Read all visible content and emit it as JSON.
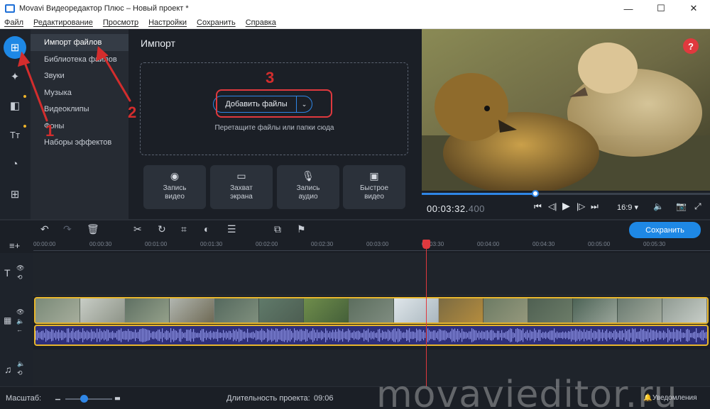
{
  "window": {
    "title": "Movavi Видеоредактор Плюс – Новый проект *",
    "minimize_glyph": "—",
    "maximize_glyph": "☐",
    "close_glyph": "✕"
  },
  "menu": [
    "Файл",
    "Редактирование",
    "Просмотр",
    "Настройки",
    "Сохранить",
    "Справка"
  ],
  "rail": [
    {
      "icon": "import-icon",
      "glyph": "⊞",
      "active": true
    },
    {
      "icon": "filters-magic-icon",
      "glyph": "✦",
      "active": false
    },
    {
      "icon": "transitions-icon",
      "glyph": "◧",
      "active": false
    },
    {
      "icon": "titles-icon",
      "glyph": "Tт",
      "active": false
    },
    {
      "icon": "stickers-icon",
      "glyph": "◔",
      "active": false
    },
    {
      "icon": "more-tools-icon",
      "glyph": "⊞",
      "active": false
    }
  ],
  "categories": [
    "Импорт файлов",
    "Библиотека файлов",
    "Звуки",
    "Музыка",
    "Видеоклипы",
    "Фоны",
    "Наборы эффектов"
  ],
  "import": {
    "title": "Импорт",
    "add_files_label": "Добавить файлы",
    "drop_hint": "Перетащите файлы или папки сюда",
    "tiles": [
      {
        "label_line1": "Запись",
        "label_line2": "видео",
        "icon": "webcam-icon",
        "glyph": "◉"
      },
      {
        "label_line1": "Захват",
        "label_line2": "экрана",
        "icon": "screen-capture-icon",
        "glyph": "▭"
      },
      {
        "label_line1": "Запись",
        "label_line2": "аудио",
        "icon": "microphone-icon",
        "glyph": "🎙"
      },
      {
        "label_line1": "Быстрое",
        "label_line2": "видео",
        "icon": "quick-video-icon",
        "glyph": "▣"
      }
    ]
  },
  "annotations": {
    "one": "1",
    "two": "2",
    "three": "3"
  },
  "preview": {
    "help_label": "?",
    "timecode_main": "00:03:32.",
    "timecode_ms": "400",
    "aspect_ratio": "16:9 ▾",
    "playback_progress_percent": 39.5
  },
  "timeline": {
    "save_label": "Сохранить",
    "ruler_ticks": [
      "00:00:00",
      "00:00:30",
      "00:01:00",
      "00:01:30",
      "00:02:00",
      "00:02:30",
      "00:03:00",
      "00:03:30",
      "00:04:00",
      "00:04:30",
      "00:05:00",
      "00:05:30"
    ]
  },
  "status": {
    "scale_label": "Масштаб:",
    "duration_label": "Длительность проекта:",
    "duration_value": "09:06",
    "notifications_label": "Уведомления",
    "zoom_level_percent": 40
  },
  "watermark": "movavieditor.ru",
  "colors": {
    "accent": "#1e88e5",
    "annotation_red": "#d32d2d",
    "clip_border": "#e8b62c",
    "playhead": "#e0393e"
  }
}
